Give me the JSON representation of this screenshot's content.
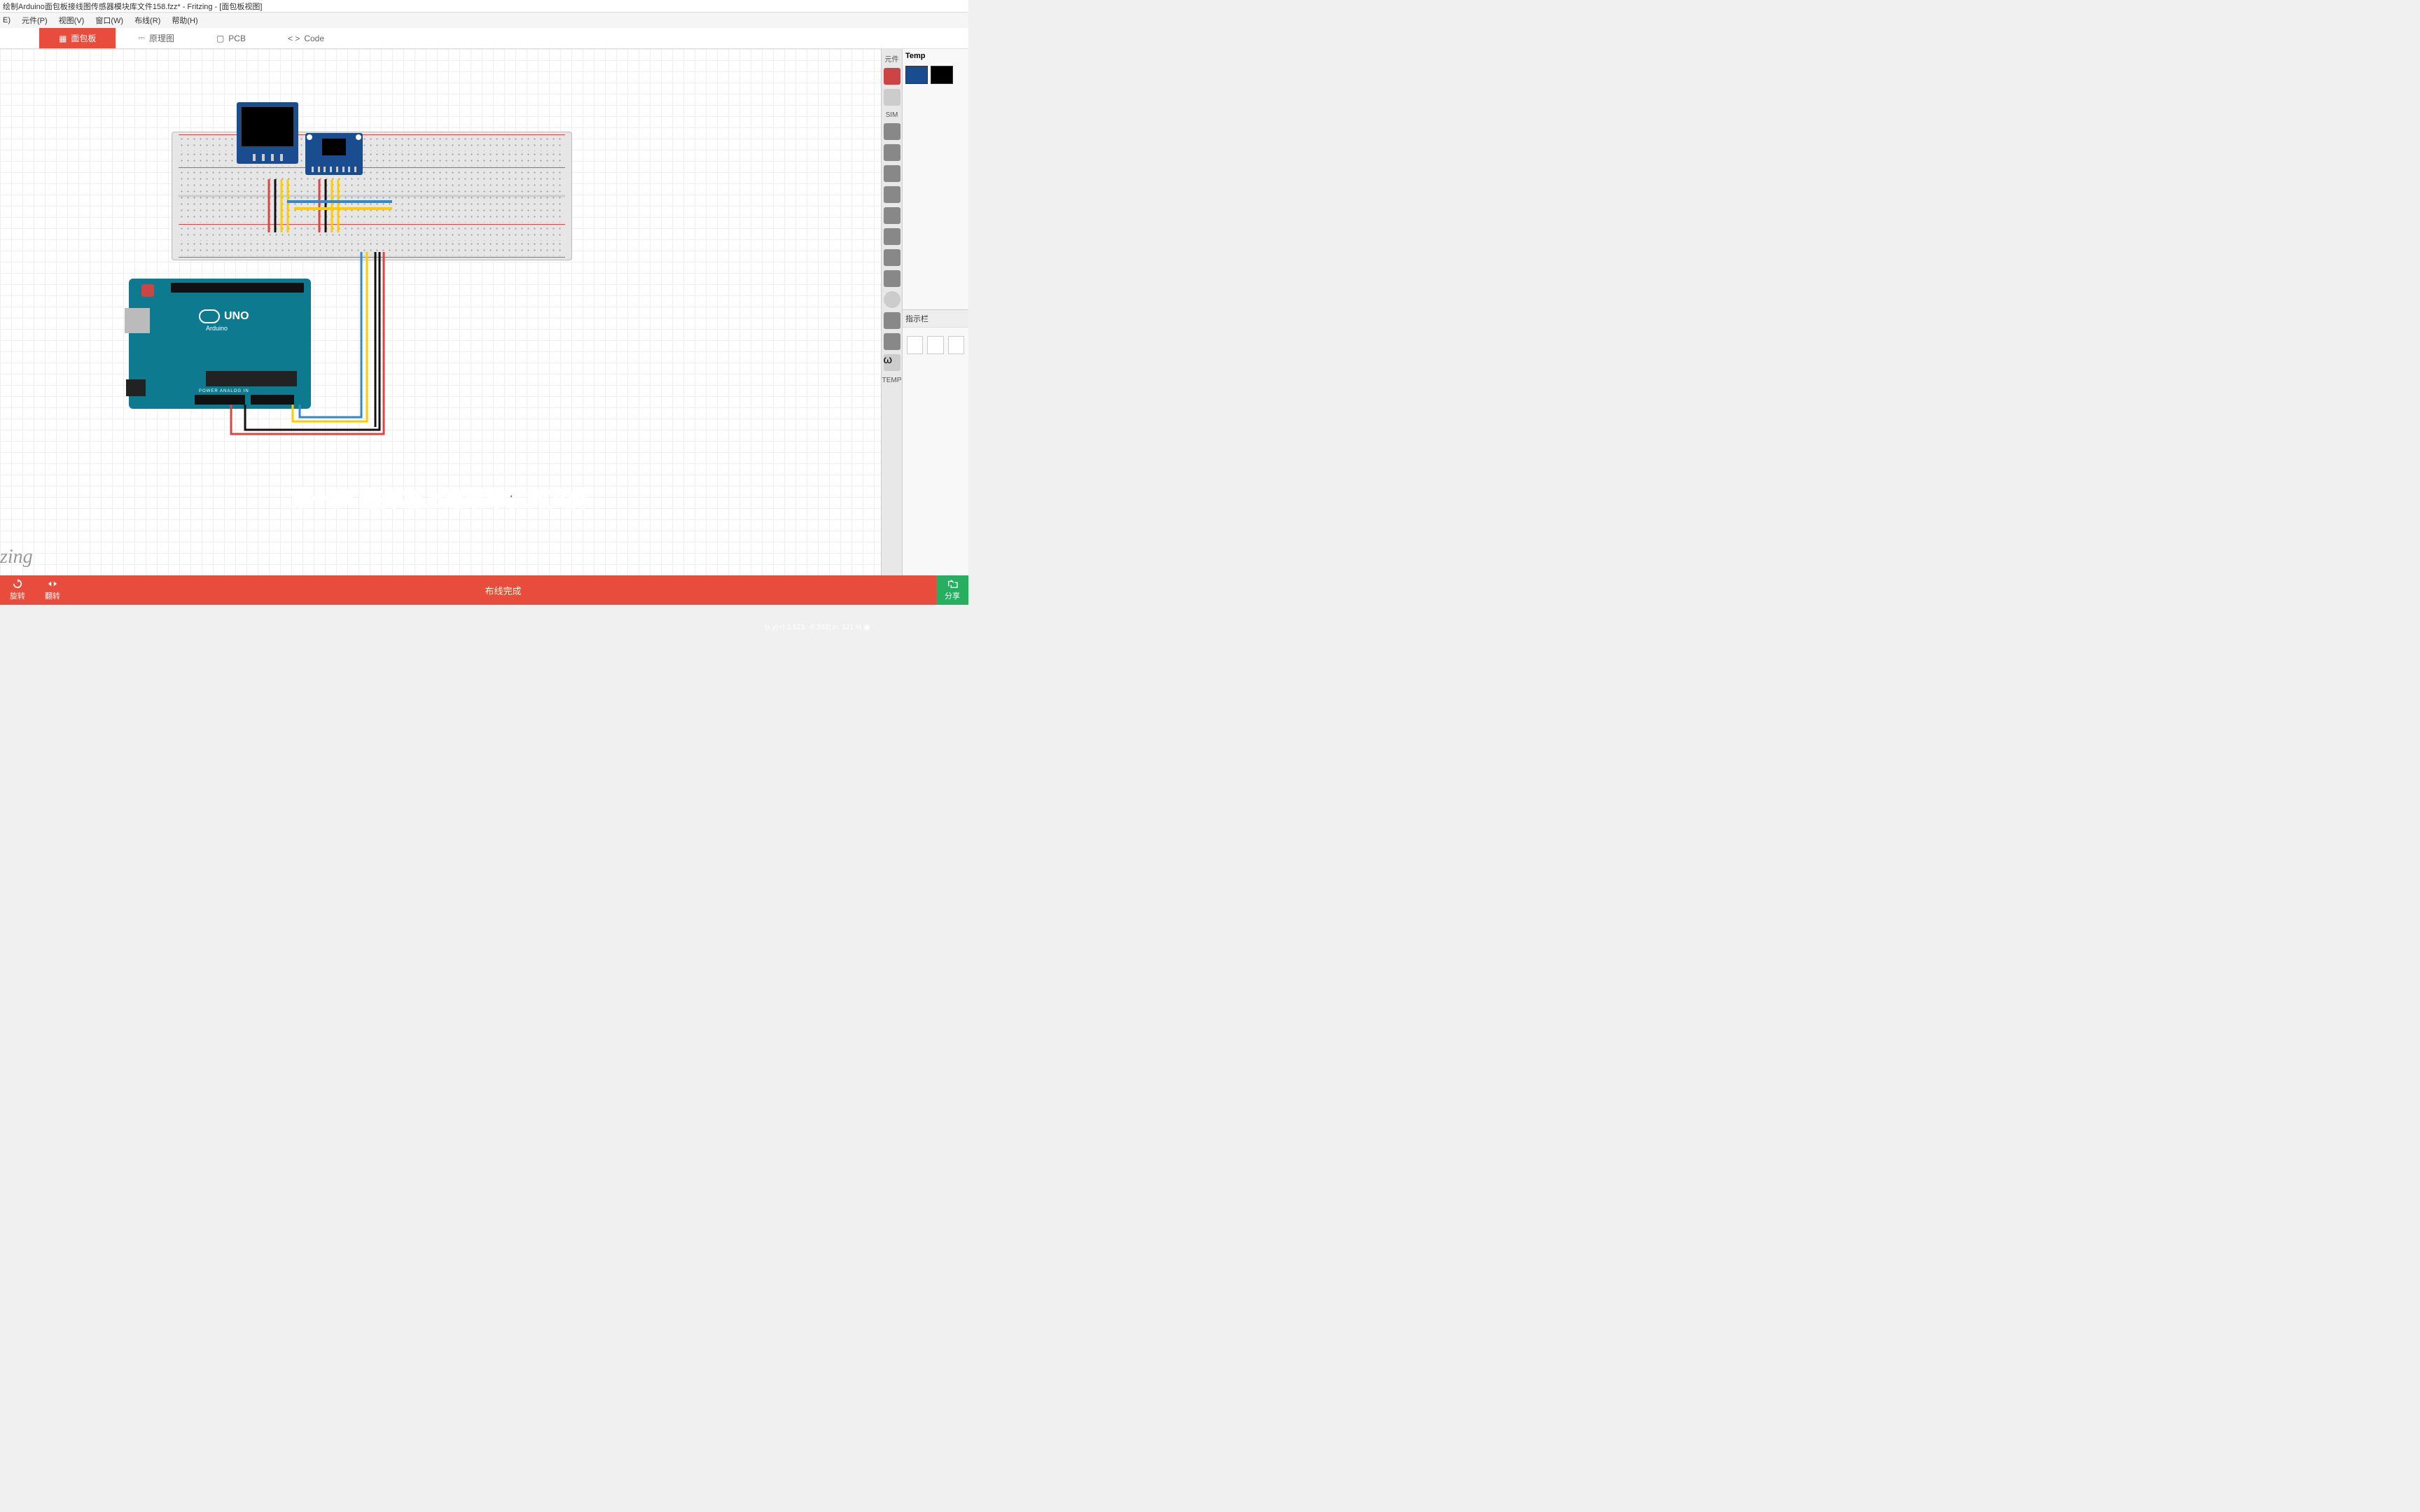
{
  "title": "绘制Arduino面包板接线图传感器模块库文件158.fzz* - Fritzing - [面包板视图]",
  "menu": {
    "file": "E)",
    "edit": "元件(P)",
    "view": "视图(V)",
    "window": "窗口(W)",
    "route": "布线(R)",
    "help": "帮助(H)"
  },
  "tabs": {
    "welcome": "",
    "breadboard": "面包板",
    "schematic": "原理图",
    "pcb": "PCB",
    "code": "Code"
  },
  "rightbar": {
    "parts_label": "元件",
    "sim_label": "SIM",
    "temp_label": "TEMP"
  },
  "parts": {
    "bin_title": "Temp"
  },
  "inspector": {
    "title": "指示栏"
  },
  "bottom": {
    "rotate": "旋转",
    "flip": "翻转",
    "status": "布线完成",
    "share": "分享"
  },
  "status": {
    "coords": "(x,y)=(-3.523, -0.393) in",
    "zoom": "121 %"
  },
  "watermark": "zing",
  "subtitle": "第一步 选择左上角菜单栏的文件",
  "arduino": {
    "brand": "UNO",
    "sub": "Arduino",
    "labels": "POWER          ANALOG IN"
  }
}
